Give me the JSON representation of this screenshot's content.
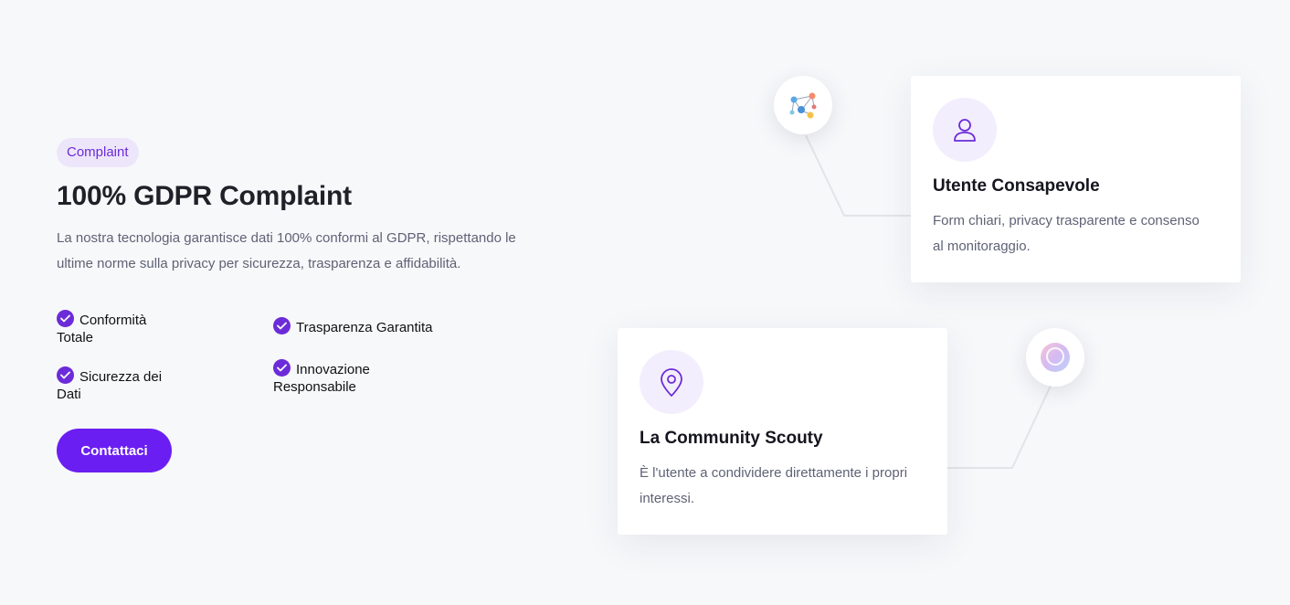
{
  "badge": "Complaint",
  "headline": "100% GDPR Complaint",
  "description": "La nostra tecnologia garantisce dati 100% conformi al GDPR, rispettando le ultime norme sulla privacy per sicurezza, trasparenza e affidabilità.",
  "features": [
    {
      "label": "Conformità Totale"
    },
    {
      "label": "Trasparenza Garantita"
    },
    {
      "label": "Sicurezza dei Dati"
    },
    {
      "label": "Innovazione Responsabile"
    }
  ],
  "cta_label": "Contattaci",
  "cards": [
    {
      "title": "Utente Consapevole",
      "text": "Form chiari, privacy trasparente e consenso al monitoraggio.",
      "icon": "user-icon"
    },
    {
      "title": "La Community Scouty",
      "text": "È l'utente a condividere direttamente i propri interessi.",
      "icon": "location-pin-icon"
    }
  ],
  "nodes": [
    {
      "icon": "network-people-icon"
    },
    {
      "icon": "gradient-search-icon"
    }
  ],
  "colors": {
    "accent": "#6a1ef2",
    "badge_bg": "#ede6fb",
    "badge_text": "#6c2bd9",
    "background": "#f7f8fa"
  }
}
